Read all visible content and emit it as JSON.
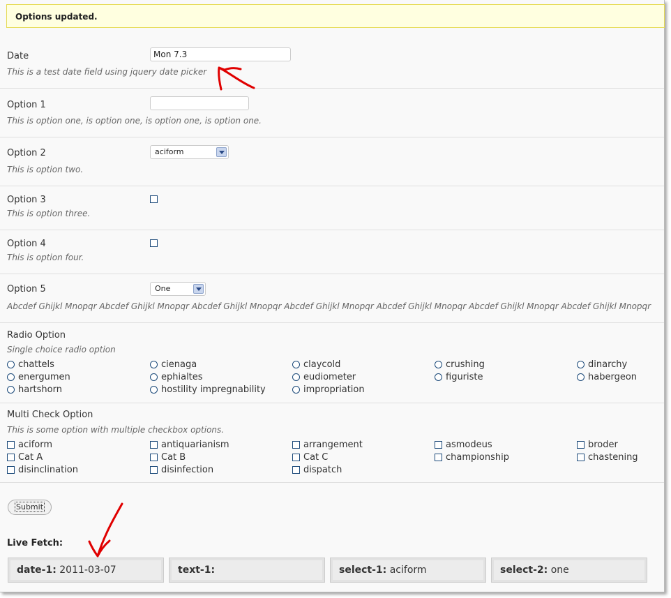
{
  "notice": "Options updated.",
  "date_field": {
    "label": "Date",
    "value": "Mon 7.3",
    "description": "This is a test date field using jquery date picker"
  },
  "option1": {
    "label": "Option 1",
    "value": "",
    "description": "This is option one, is option one, is option one, is option one."
  },
  "option2": {
    "label": "Option 2",
    "selected": "aciform",
    "description": "This is option two."
  },
  "option3": {
    "label": "Option 3",
    "checked": false,
    "description": "This is option three."
  },
  "option4": {
    "label": "Option 4",
    "checked": false,
    "description": "This is option four."
  },
  "option5": {
    "label": "Option 5",
    "selected": "One",
    "description": "Abcdef Ghijkl Mnopqr Abcdef Ghijkl Mnopqr Abcdef Ghijkl Mnopqr Abcdef Ghijkl Mnopqr Abcdef Ghijkl Mnopqr Abcdef Ghijkl Mnopqr Abcdef Ghijkl Mnopqr"
  },
  "radio": {
    "label": "Radio Option",
    "description": "Single choice radio option",
    "options": [
      "chattels",
      "cienaga",
      "claycold",
      "crushing",
      "dinarchy",
      "energumen",
      "ephialtes",
      "eudiometer",
      "figuriste",
      "habergeon",
      "hartshorn",
      "hostility impregnability",
      "impropriation"
    ]
  },
  "multicheck": {
    "label": "Multi Check Option",
    "description": "This is some option with multiple checkbox options.",
    "options": [
      "aciform",
      "antiquarianism",
      "arrangement",
      "asmodeus",
      "broder",
      "Cat A",
      "Cat B",
      "Cat C",
      "championship",
      "chastening",
      "disinclination",
      "disinfection",
      "dispatch"
    ]
  },
  "submit_label": "Submit",
  "live_fetch": {
    "title": "Live Fetch:",
    "items": [
      {
        "key": "date-1:",
        "value": "2011-03-07"
      },
      {
        "key": "text-1:",
        "value": ""
      },
      {
        "key": "select-1:",
        "value": "aciform"
      },
      {
        "key": "select-2:",
        "value": "one"
      }
    ]
  },
  "annotation_color": "#e00000"
}
